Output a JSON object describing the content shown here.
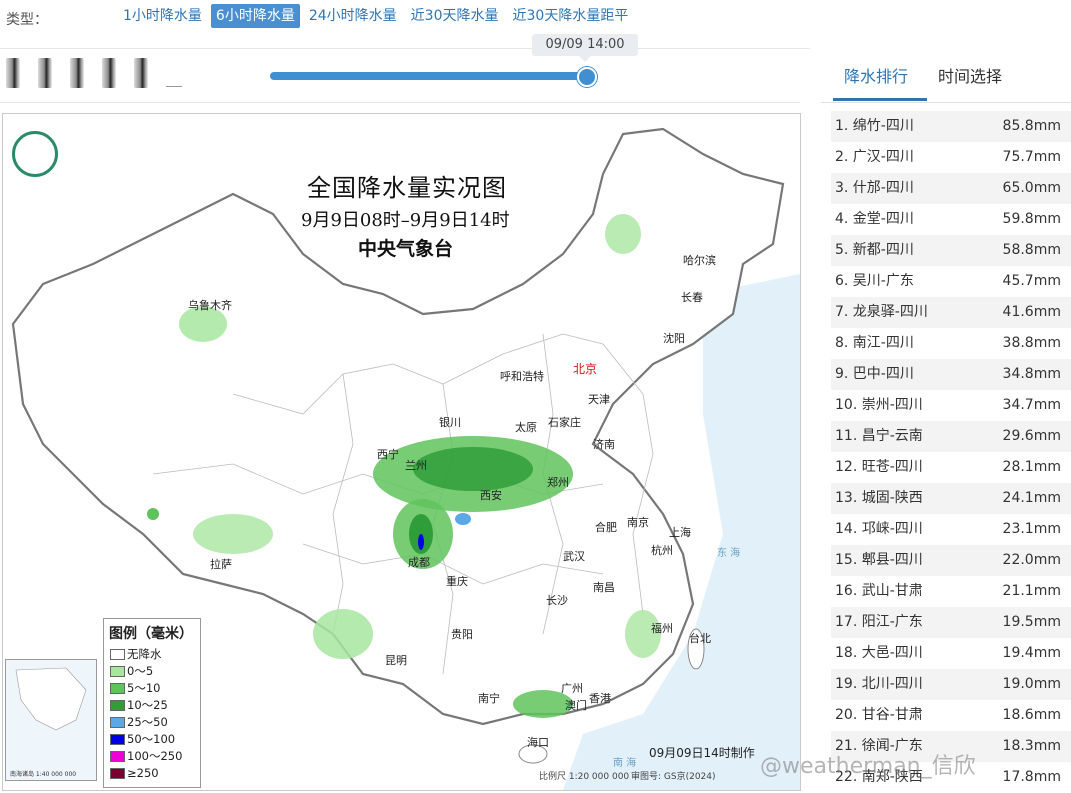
{
  "typebar": {
    "label": "类型：",
    "tabs": [
      {
        "label": "1小时降水量",
        "active": false
      },
      {
        "label": "6小时降水量",
        "active": true
      },
      {
        "label": "24小时降水量",
        "active": false
      },
      {
        "label": "近30天降水量",
        "active": false
      },
      {
        "label": "近30天降水量距平",
        "active": false
      }
    ]
  },
  "slider": {
    "tooltip": "09/09 14:00",
    "progress_fraction": 1.0
  },
  "map": {
    "title": "全国降水量实况图",
    "subtitle": "9月9日08时–9月9日14时",
    "org": "中央气象台",
    "made_time": "09月09日14时制作",
    "scale": "比例尺 1:20 000 000",
    "review_no": "审图号: GS京(2024)",
    "inset_caption": "南海诸岛\n1:40 000 000",
    "capital": "北京",
    "cities": [
      "乌鲁木齐",
      "哈尔滨",
      "长春",
      "沈阳",
      "呼和浩特",
      "天津",
      "石家庄",
      "银川",
      "太原",
      "济南",
      "西宁",
      "兰州",
      "郑州",
      "西安",
      "合肥",
      "南京",
      "上海",
      "拉萨",
      "成都",
      "武汉",
      "杭州",
      "重庆",
      "长沙",
      "南昌",
      "贵阳",
      "福州",
      "台北",
      "昆明",
      "南宁",
      "广州",
      "香港",
      "澳门",
      "海口"
    ],
    "seas": [
      "东 海",
      "南 海"
    ],
    "legend": {
      "title": "图例（毫米）",
      "items": [
        {
          "label": "无降水",
          "color": "#ffffff"
        },
        {
          "label": "0～5",
          "color": "#a8e6a0"
        },
        {
          "label": "5～10",
          "color": "#5fc35c"
        },
        {
          "label": "10～25",
          "color": "#2f9e3a"
        },
        {
          "label": "25～50",
          "color": "#5aa8e6"
        },
        {
          "label": "50～100",
          "color": "#0000e6"
        },
        {
          "label": "100～250",
          "color": "#f000d8"
        },
        {
          "label": "≥250",
          "color": "#7a0030"
        }
      ]
    }
  },
  "rank_panel": {
    "tabs": [
      {
        "label": "降水排行",
        "active": true
      },
      {
        "label": "时间选择",
        "active": false
      }
    ],
    "items": [
      {
        "name": "1. 绵竹-四川",
        "value": "85.8mm"
      },
      {
        "name": "2. 广汉-四川",
        "value": "75.7mm"
      },
      {
        "name": "3. 什邡-四川",
        "value": "65.0mm"
      },
      {
        "name": "4. 金堂-四川",
        "value": "59.8mm"
      },
      {
        "name": "5. 新都-四川",
        "value": "58.8mm"
      },
      {
        "name": "6. 吴川-广东",
        "value": "45.7mm"
      },
      {
        "name": "7. 龙泉驿-四川",
        "value": "41.6mm"
      },
      {
        "name": "8. 南江-四川",
        "value": "38.8mm"
      },
      {
        "name": "9. 巴中-四川",
        "value": "34.8mm"
      },
      {
        "name": "10. 崇州-四川",
        "value": "34.7mm"
      },
      {
        "name": "11. 昌宁-云南",
        "value": "29.6mm"
      },
      {
        "name": "12. 旺苍-四川",
        "value": "28.1mm"
      },
      {
        "name": "13. 城固-陕西",
        "value": "24.1mm"
      },
      {
        "name": "14. 邛崃-四川",
        "value": "23.1mm"
      },
      {
        "name": "15. 郫县-四川",
        "value": "22.0mm"
      },
      {
        "name": "16. 武山-甘肃",
        "value": "21.1mm"
      },
      {
        "name": "17. 阳江-广东",
        "value": "19.5mm"
      },
      {
        "name": "18. 大邑-四川",
        "value": "19.4mm"
      },
      {
        "name": "19. 北川-四川",
        "value": "19.0mm"
      },
      {
        "name": "20. 甘谷-甘肃",
        "value": "18.6mm"
      },
      {
        "name": "21. 徐闻-广东",
        "value": "18.3mm"
      },
      {
        "name": "22. 南郑-陕西",
        "value": "17.8mm"
      }
    ]
  },
  "watermark": "@weatherman_信欣"
}
